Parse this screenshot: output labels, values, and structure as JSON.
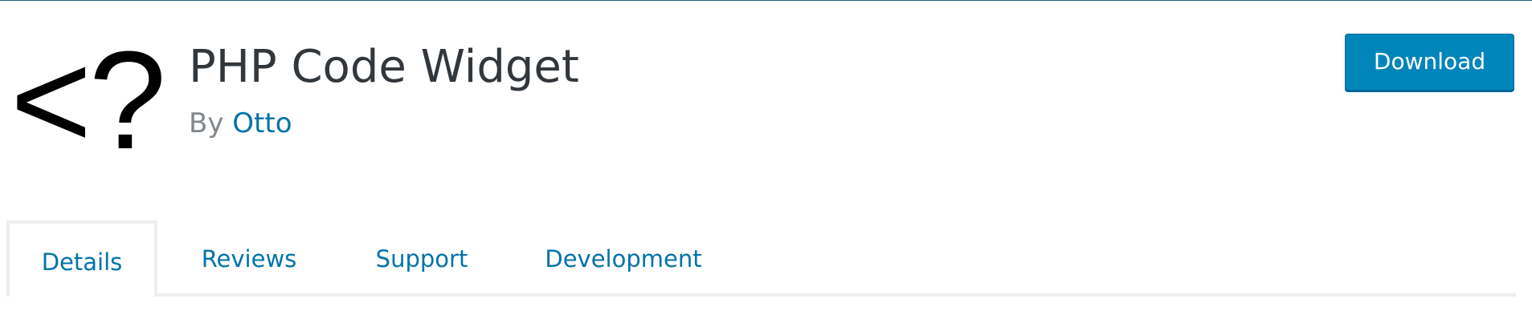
{
  "plugin": {
    "icon_glyph": "<?",
    "title": "PHP Code Widget",
    "byline_prefix": "By",
    "author": "Otto"
  },
  "actions": {
    "download_label": "Download"
  },
  "tabs": [
    {
      "label": "Details",
      "active": true
    },
    {
      "label": "Reviews",
      "active": false
    },
    {
      "label": "Support",
      "active": false
    },
    {
      "label": "Development",
      "active": false
    }
  ],
  "colors": {
    "link": "#0073aa",
    "button": "#0085ba",
    "title": "#32373c",
    "byline": "#82878c"
  }
}
